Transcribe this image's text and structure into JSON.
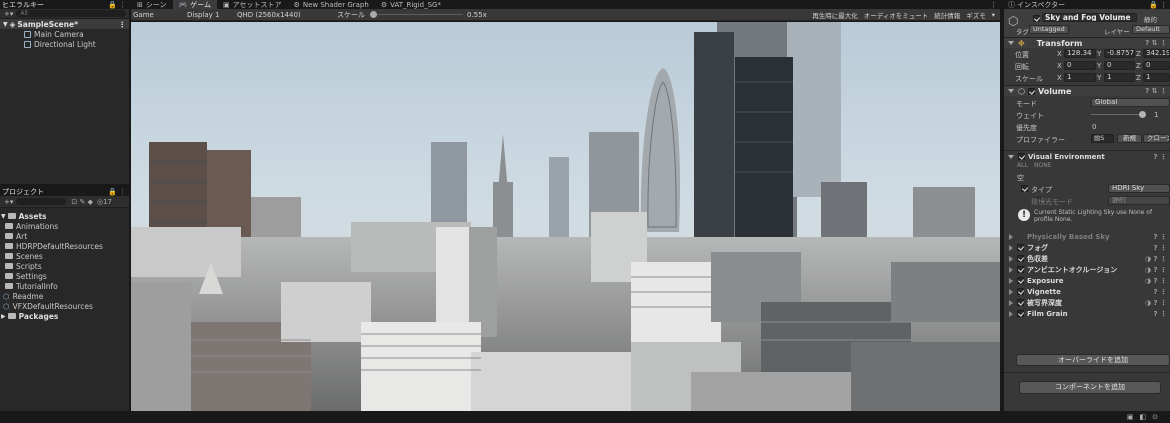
{
  "hierarchy": {
    "tab": "ヒエラルキー",
    "search_placeholder": "All",
    "scene": "SampleScene*",
    "items": [
      "Main Camera",
      "Directional Light"
    ]
  },
  "project": {
    "tab": "プロジェクト",
    "count": "17",
    "root": "Assets",
    "folders": [
      "Animations",
      "Art",
      "HDRPDefaultResources",
      "Scenes",
      "Scripts",
      "Settings",
      "TutorialInfo"
    ],
    "files": [
      "Readme",
      "VFXDefaultResources"
    ],
    "packages": "Packages"
  },
  "tabs": [
    "シーン",
    "ゲーム",
    "アセットストア",
    "New Shader Graph",
    "VAT_Rigid_SG*"
  ],
  "game_toolbar": {
    "mode": "Game",
    "display": "Display 1",
    "resolution": "QHD (2560x1440)",
    "scale_label": "スケール",
    "scale_value": "0.55x",
    "scale_level": 0.0,
    "buttons": [
      "再生時に最大化",
      "オーディオをミュート",
      "統計情報",
      "ギズモ"
    ]
  },
  "inspector": {
    "tab": "インスペクター",
    "object_name": "Sky and Fog Volume",
    "static_label": "静的",
    "tag_label": "タグ",
    "tag_value": "Untagged",
    "layer_label": "レイヤー",
    "layer_value": "Default",
    "transform": {
      "title": "Transform",
      "position_label": "位置",
      "rotation_label": "回転",
      "scale_label": "スケール",
      "position": [
        "128.34",
        "-0.8757",
        "342.19"
      ],
      "rotation": [
        "0",
        "0",
        "0"
      ],
      "scale": [
        "1",
        "1",
        "1"
      ],
      "axes": [
        "X",
        "Y",
        "Z"
      ]
    },
    "volume": {
      "title": "Volume",
      "mode_label": "モード",
      "mode_value": "Global",
      "weight_label": "ウェイト",
      "weight_value": "1",
      "weight_level": 1.0,
      "priority_label": "優先度",
      "priority_value": "0",
      "profile_label": "プロファイラー",
      "profile_value": "S",
      "new_button": "新規",
      "clone_button": "クローン"
    },
    "visual_env": {
      "title": "Visual Environment",
      "all": "ALL",
      "none": "NONE",
      "sky_section": "空",
      "type_label": "タイプ",
      "type_value": "HDRI Sky",
      "ambient_label": "環境光モード",
      "ambient_value": "静的",
      "warning": "Current Static Lighting Sky use None of profile None."
    },
    "overrides": [
      {
        "label": "Physically Based Sky",
        "enabled": false
      },
      {
        "label": "フォグ",
        "enabled": true
      },
      {
        "label": "色収差",
        "enabled": true
      },
      {
        "label": "アンビエントオクルージョン",
        "enabled": true
      },
      {
        "label": "Exposure",
        "enabled": true
      },
      {
        "label": "Vignette",
        "enabled": true
      },
      {
        "label": "被写界深度",
        "enabled": true
      },
      {
        "label": "Film Grain",
        "enabled": true
      }
    ],
    "add_override": "オーバーライドを追加",
    "add_component": "コンポーネントを追加"
  }
}
